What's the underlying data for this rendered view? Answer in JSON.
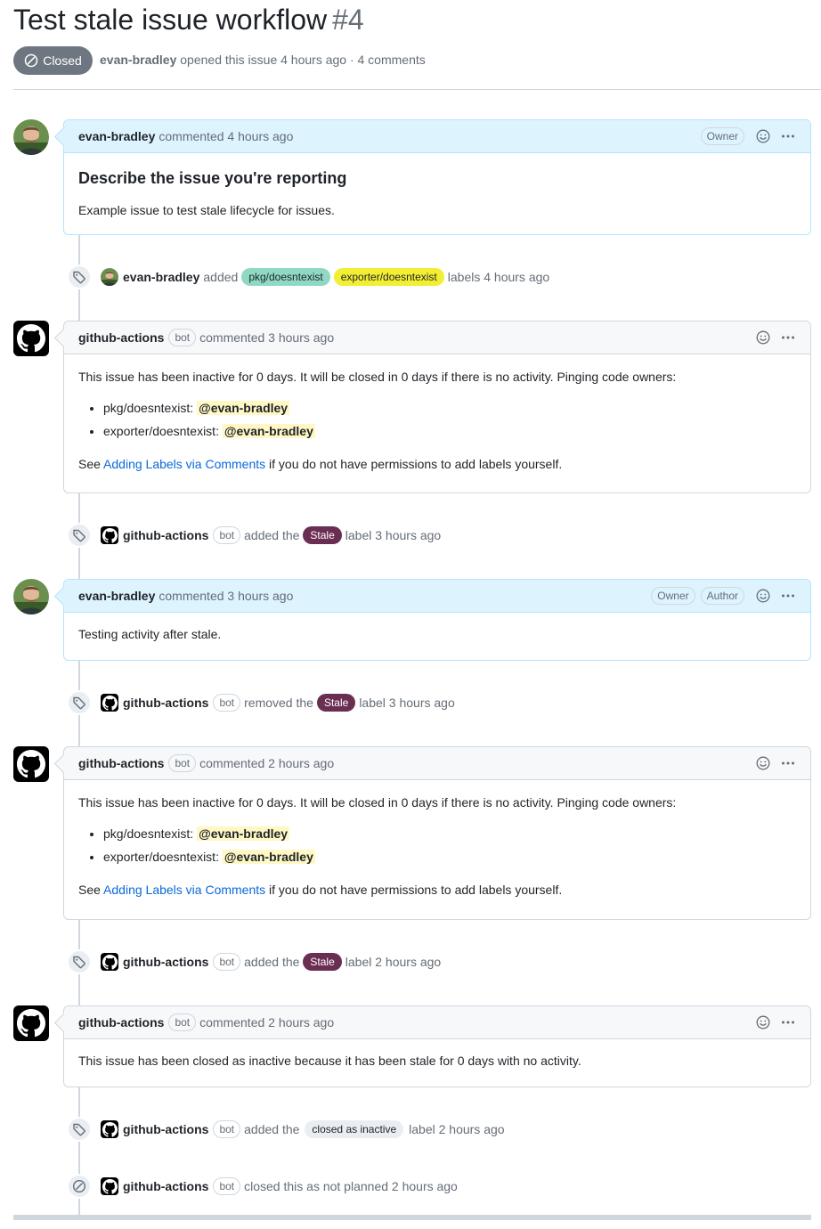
{
  "issue": {
    "title": "Test stale issue workflow",
    "number": "#4",
    "state": "Closed",
    "author": "evan-bradley",
    "meta": "opened this issue 4 hours ago · 4 comments"
  },
  "comments": [
    {
      "author": "evan-bradley",
      "when": "commented 4 hours ago",
      "badges": [
        "Owner"
      ],
      "heading": "Describe the issue you're reporting",
      "body": "Example issue to test stale lifecycle for issues."
    },
    {
      "author": "github-actions",
      "bot": "bot",
      "when": "commented 3 hours ago",
      "intro": "This issue has been inactive for 0 days. It will be closed in 0 days if there is no activity. Pinging code owners:",
      "items": [
        {
          "label": "pkg/doesntexist:",
          "mention": "@evan-bradley"
        },
        {
          "label": "exporter/doesntexist:",
          "mention": "@evan-bradley"
        }
      ],
      "see": "See",
      "link": "Adding Labels via Comments",
      "tail": "if you do not have permissions to add labels yourself."
    },
    {
      "author": "evan-bradley",
      "when": "commented 3 hours ago",
      "badges": [
        "Owner",
        "Author"
      ],
      "body": "Testing activity after stale."
    },
    {
      "author": "github-actions",
      "bot": "bot",
      "when": "commented 2 hours ago",
      "intro": "This issue has been inactive for 0 days. It will be closed in 0 days if there is no activity. Pinging code owners:",
      "items": [
        {
          "label": "pkg/doesntexist:",
          "mention": "@evan-bradley"
        },
        {
          "label": "exporter/doesntexist:",
          "mention": "@evan-bradley"
        }
      ],
      "see": "See",
      "link": "Adding Labels via Comments",
      "tail": "if you do not have permissions to add labels yourself."
    },
    {
      "author": "github-actions",
      "bot": "bot",
      "when": "commented 2 hours ago",
      "body": "This issue has been closed as inactive because it has been stale for 0 days with no activity."
    }
  ],
  "events": [
    {
      "actor": "evan-bradley",
      "verb": "added",
      "labels": [
        {
          "name": "pkg/doesntexist",
          "bg": "#8fd9c4",
          "fg": "#1f2328"
        },
        {
          "name": "exporter/doesntexist",
          "bg": "#f2ee33",
          "fg": "#1f2328"
        }
      ],
      "tail": "labels 4 hours ago"
    },
    {
      "actor": "github-actions",
      "bot": "bot",
      "verb": "added the",
      "labels": [
        {
          "name": "Stale",
          "bg": "#6b2e53",
          "fg": "#ffffff"
        }
      ],
      "tail": "label 3 hours ago"
    },
    {
      "actor": "github-actions",
      "bot": "bot",
      "verb": "removed the",
      "labels": [
        {
          "name": "Stale",
          "bg": "#6b2e53",
          "fg": "#ffffff"
        }
      ],
      "tail": "label 3 hours ago"
    },
    {
      "actor": "github-actions",
      "bot": "bot",
      "verb": "added the",
      "labels": [
        {
          "name": "Stale",
          "bg": "#6b2e53",
          "fg": "#ffffff"
        }
      ],
      "tail": "label 2 hours ago"
    },
    {
      "actor": "github-actions",
      "bot": "bot",
      "verb": "added the",
      "labels": [
        {
          "name": "closed as inactive",
          "bg": "#eaeef2",
          "fg": "#1f2328"
        }
      ],
      "tail": "label 2 hours ago"
    },
    {
      "actor": "github-actions",
      "bot": "bot",
      "verb": "closed this as not planned 2 hours ago"
    }
  ],
  "icons": {
    "state": "skip-circle-icon",
    "label_event": "tag-icon",
    "close_event": "skip-circle-icon",
    "react": "smiley-icon",
    "more": "kebab-horizontal-icon",
    "bot_avatar": "github-mark-icon"
  }
}
